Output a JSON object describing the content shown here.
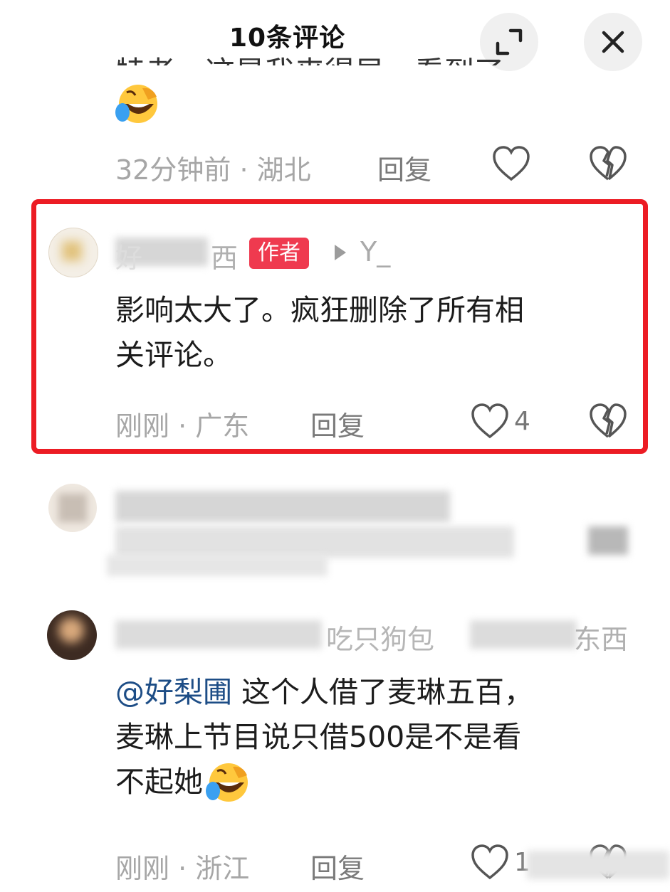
{
  "header": {
    "title": "10条评论",
    "expand_icon": "expand-icon",
    "close_icon": "close-icon"
  },
  "comment_prev": {
    "time": "32分钟前",
    "location": "湖北",
    "reply_label": "回复"
  },
  "comment_author": {
    "username": "好",
    "username_tail": "西",
    "badge": "作者",
    "reply_to": "Y_",
    "text_line1": "影响太大了。疯狂删除了所有相",
    "text_line2": "关评论。",
    "time": "刚刚",
    "location": "广东",
    "reply_label": "回复",
    "like_count": "4"
  },
  "comment_last": {
    "username_visible": "吃只狗包",
    "username_tail": "东西",
    "mention": "@好梨圃",
    "text_line1": "这个人借了麦琳五百，",
    "text_line2": "麦琳上节目说只借500是不是看",
    "text_line3": "不起她",
    "time": "刚刚",
    "location": "浙江",
    "reply_label": "回复",
    "like_count": "1"
  },
  "colors": {
    "highlight_border": "#ec1c24",
    "author_badge": "#ef3a4f",
    "mention": "#1d4d86"
  }
}
